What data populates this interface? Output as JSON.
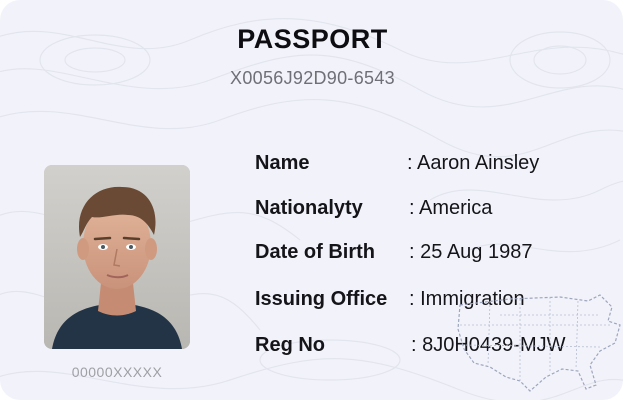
{
  "card": {
    "title": "PASSPORT",
    "number": "X0056J92D90-6543",
    "photo_caption": "00000XXXXX",
    "fields": [
      {
        "label": "Name",
        "value": ": Aaron Ainsley"
      },
      {
        "label": "Nationalyty",
        "value": ": America"
      },
      {
        "label": "Date of Birth",
        "value": ": 25 Aug 1987"
      },
      {
        "label": "Issuing Office",
        "value": ": Immigration"
      },
      {
        "label": "Reg No",
        "value": ": 8J0H0439-MJW"
      }
    ]
  },
  "icons": {
    "background": "topographic-pattern",
    "map": "usa-map-outline"
  },
  "colors": {
    "card_background": "#f2f3fa",
    "text_primary": "#141419",
    "text_muted": "#6f7077"
  }
}
